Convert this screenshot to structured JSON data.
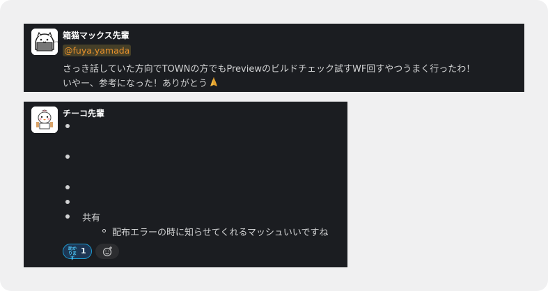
{
  "messages": [
    {
      "author": "箱猫マックス先輩",
      "mention": "@fuya.yamada",
      "lines": [
        "さっき話していた方向でTOWNの方でもPreviewのビルドチェック試すWF回すやつうまく行ったわ！",
        "いやー、参考になった！ありがとう"
      ],
      "trailing_emoji": "folded-hands-emoji"
    },
    {
      "author": "チーコ先輩",
      "bullets": [
        "",
        "",
        "",
        "",
        "共有"
      ],
      "sub_bullets": [
        "配布エラーの時に知らせてくれるマッシュいいですね"
      ],
      "reaction": {
        "emoji": "custom-reaction-emoji",
        "emoji_text": "助かります",
        "count": "1"
      },
      "add_reaction_icon": "add-reaction-icon"
    }
  ],
  "colors": {
    "message_bg": "#1b1d21",
    "page_bg": "#f0f0f1",
    "mention": "#e8912d",
    "reaction_border": "#1d9bd1"
  }
}
